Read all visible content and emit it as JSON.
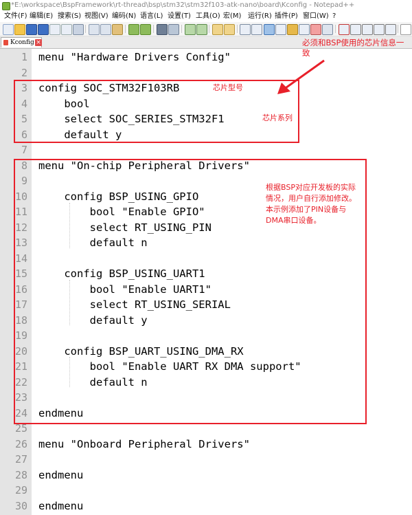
{
  "window": {
    "title": "*E:\\workspace\\BspFramework\\rt-thread\\bsp\\stm32\\stm32f103-atk-nano\\board\\Kconfig - Notepad++"
  },
  "menu": [
    "文件(F)",
    "编辑(E)",
    "搜索(S)",
    "视图(V)",
    "编码(N)",
    "语言(L)",
    "设置(T)",
    "工具(O)",
    "宏(M)",
    "运行(R)",
    "插件(P)",
    "窗口(W)",
    "?"
  ],
  "tab": {
    "label": "Kconfig",
    "close": "×"
  },
  "line_numbers": [
    "1",
    "2",
    "3",
    "4",
    "5",
    "6",
    "7",
    "8",
    "9",
    "10",
    "11",
    "12",
    "13",
    "14",
    "15",
    "16",
    "17",
    "18",
    "19",
    "20",
    "21",
    "22",
    "23",
    "24",
    "25",
    "26",
    "27",
    "28",
    "29",
    "30"
  ],
  "code_lines": [
    "menu \"Hardware Drivers Config\"",
    "",
    "config SOC_STM32F103RB",
    "    bool",
    "    select SOC_SERIES_STM32F1",
    "    default y",
    "",
    "menu \"On-chip Peripheral Drivers\"",
    "",
    "    config BSP_USING_GPIO",
    "        bool \"Enable GPIO\"",
    "        select RT_USING_PIN",
    "        default n",
    "",
    "    config BSP_USING_UART1",
    "        bool \"Enable UART1\"",
    "        select RT_USING_SERIAL",
    "        default y",
    "",
    "    config BSP_UART_USING_DMA_RX",
    "        bool \"Enable UART RX DMA support\"",
    "        default n",
    "",
    "endmenu",
    "",
    "menu \"Onboard Peripheral Drivers\"",
    "",
    "endmenu",
    "",
    "endmenu"
  ],
  "annotations": {
    "top": "必须和BSP使用的芯片信息一致",
    "chip_model": "芯片型号",
    "chip_series": "芯片系列",
    "peripheral_note": "根据BSP对应开发板的实际情况，用户自行添加修改。本示例添加了PIN设备与DMA串口设备。"
  },
  "colors": {
    "annotation_red": "#e8202a",
    "gutter_bg": "#e4e4e4",
    "line_number": "#909090"
  }
}
